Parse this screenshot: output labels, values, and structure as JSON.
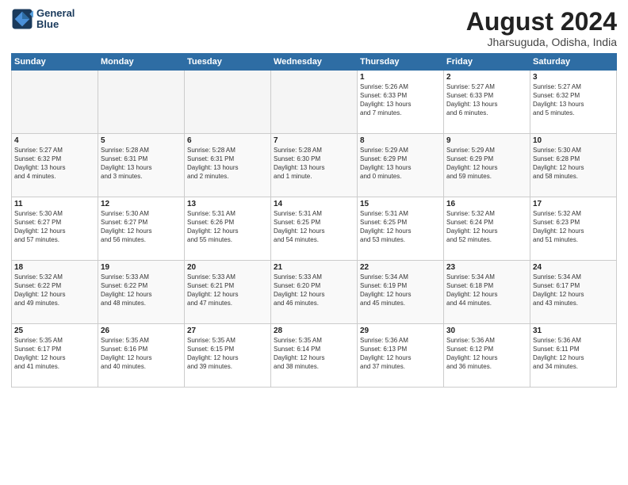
{
  "header": {
    "logo_line1": "General",
    "logo_line2": "Blue",
    "title": "August 2024",
    "subtitle": "Jharsuguda, Odisha, India"
  },
  "days_of_week": [
    "Sunday",
    "Monday",
    "Tuesday",
    "Wednesday",
    "Thursday",
    "Friday",
    "Saturday"
  ],
  "weeks": [
    [
      {
        "day": "",
        "info": ""
      },
      {
        "day": "",
        "info": ""
      },
      {
        "day": "",
        "info": ""
      },
      {
        "day": "",
        "info": ""
      },
      {
        "day": "1",
        "info": "Sunrise: 5:26 AM\nSunset: 6:33 PM\nDaylight: 13 hours\nand 7 minutes."
      },
      {
        "day": "2",
        "info": "Sunrise: 5:27 AM\nSunset: 6:33 PM\nDaylight: 13 hours\nand 6 minutes."
      },
      {
        "day": "3",
        "info": "Sunrise: 5:27 AM\nSunset: 6:32 PM\nDaylight: 13 hours\nand 5 minutes."
      }
    ],
    [
      {
        "day": "4",
        "info": "Sunrise: 5:27 AM\nSunset: 6:32 PM\nDaylight: 13 hours\nand 4 minutes."
      },
      {
        "day": "5",
        "info": "Sunrise: 5:28 AM\nSunset: 6:31 PM\nDaylight: 13 hours\nand 3 minutes."
      },
      {
        "day": "6",
        "info": "Sunrise: 5:28 AM\nSunset: 6:31 PM\nDaylight: 13 hours\nand 2 minutes."
      },
      {
        "day": "7",
        "info": "Sunrise: 5:28 AM\nSunset: 6:30 PM\nDaylight: 13 hours\nand 1 minute."
      },
      {
        "day": "8",
        "info": "Sunrise: 5:29 AM\nSunset: 6:29 PM\nDaylight: 13 hours\nand 0 minutes."
      },
      {
        "day": "9",
        "info": "Sunrise: 5:29 AM\nSunset: 6:29 PM\nDaylight: 12 hours\nand 59 minutes."
      },
      {
        "day": "10",
        "info": "Sunrise: 5:30 AM\nSunset: 6:28 PM\nDaylight: 12 hours\nand 58 minutes."
      }
    ],
    [
      {
        "day": "11",
        "info": "Sunrise: 5:30 AM\nSunset: 6:27 PM\nDaylight: 12 hours\nand 57 minutes."
      },
      {
        "day": "12",
        "info": "Sunrise: 5:30 AM\nSunset: 6:27 PM\nDaylight: 12 hours\nand 56 minutes."
      },
      {
        "day": "13",
        "info": "Sunrise: 5:31 AM\nSunset: 6:26 PM\nDaylight: 12 hours\nand 55 minutes."
      },
      {
        "day": "14",
        "info": "Sunrise: 5:31 AM\nSunset: 6:25 PM\nDaylight: 12 hours\nand 54 minutes."
      },
      {
        "day": "15",
        "info": "Sunrise: 5:31 AM\nSunset: 6:25 PM\nDaylight: 12 hours\nand 53 minutes."
      },
      {
        "day": "16",
        "info": "Sunrise: 5:32 AM\nSunset: 6:24 PM\nDaylight: 12 hours\nand 52 minutes."
      },
      {
        "day": "17",
        "info": "Sunrise: 5:32 AM\nSunset: 6:23 PM\nDaylight: 12 hours\nand 51 minutes."
      }
    ],
    [
      {
        "day": "18",
        "info": "Sunrise: 5:32 AM\nSunset: 6:22 PM\nDaylight: 12 hours\nand 49 minutes."
      },
      {
        "day": "19",
        "info": "Sunrise: 5:33 AM\nSunset: 6:22 PM\nDaylight: 12 hours\nand 48 minutes."
      },
      {
        "day": "20",
        "info": "Sunrise: 5:33 AM\nSunset: 6:21 PM\nDaylight: 12 hours\nand 47 minutes."
      },
      {
        "day": "21",
        "info": "Sunrise: 5:33 AM\nSunset: 6:20 PM\nDaylight: 12 hours\nand 46 minutes."
      },
      {
        "day": "22",
        "info": "Sunrise: 5:34 AM\nSunset: 6:19 PM\nDaylight: 12 hours\nand 45 minutes."
      },
      {
        "day": "23",
        "info": "Sunrise: 5:34 AM\nSunset: 6:18 PM\nDaylight: 12 hours\nand 44 minutes."
      },
      {
        "day": "24",
        "info": "Sunrise: 5:34 AM\nSunset: 6:17 PM\nDaylight: 12 hours\nand 43 minutes."
      }
    ],
    [
      {
        "day": "25",
        "info": "Sunrise: 5:35 AM\nSunset: 6:17 PM\nDaylight: 12 hours\nand 41 minutes."
      },
      {
        "day": "26",
        "info": "Sunrise: 5:35 AM\nSunset: 6:16 PM\nDaylight: 12 hours\nand 40 minutes."
      },
      {
        "day": "27",
        "info": "Sunrise: 5:35 AM\nSunset: 6:15 PM\nDaylight: 12 hours\nand 39 minutes."
      },
      {
        "day": "28",
        "info": "Sunrise: 5:35 AM\nSunset: 6:14 PM\nDaylight: 12 hours\nand 38 minutes."
      },
      {
        "day": "29",
        "info": "Sunrise: 5:36 AM\nSunset: 6:13 PM\nDaylight: 12 hours\nand 37 minutes."
      },
      {
        "day": "30",
        "info": "Sunrise: 5:36 AM\nSunset: 6:12 PM\nDaylight: 12 hours\nand 36 minutes."
      },
      {
        "day": "31",
        "info": "Sunrise: 5:36 AM\nSunset: 6:11 PM\nDaylight: 12 hours\nand 34 minutes."
      }
    ]
  ]
}
